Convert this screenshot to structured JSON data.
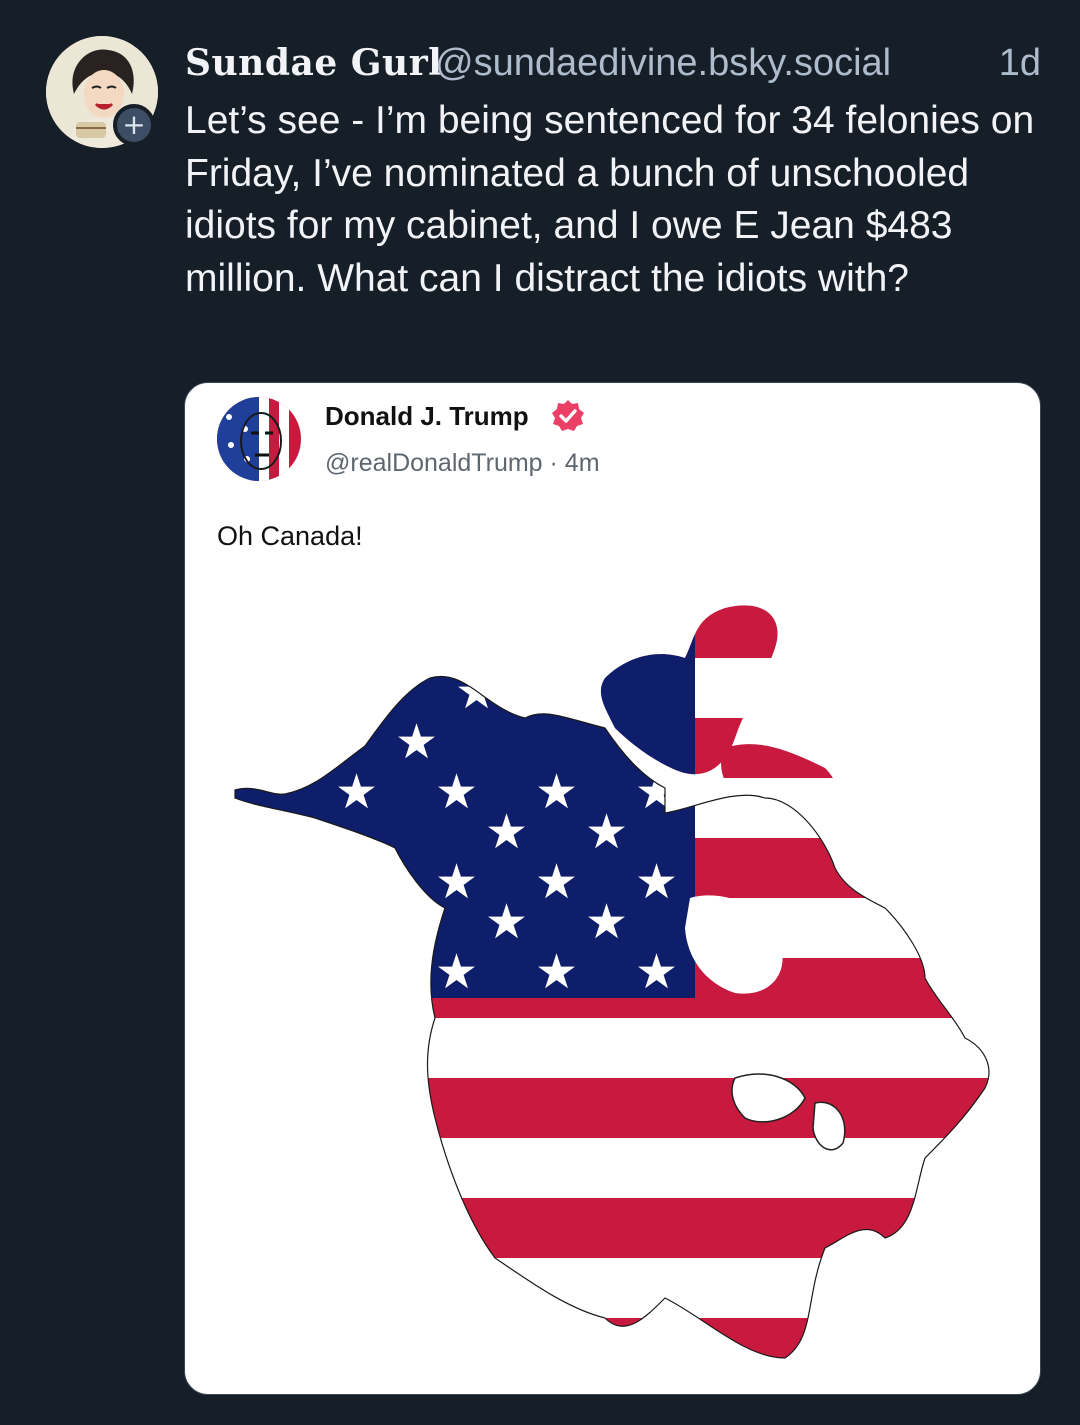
{
  "post": {
    "author_name": "Sundae Gurl",
    "handle": "@sundaedivine.bsky.social",
    "timestamp": "1d",
    "follow_label": "+",
    "text": "Let’s see - I’m being sentenced for 34 felonies on Friday, I’ve nominated a bunch of unschooled idiots for my cabinet, and I owe E Jean $483 million. What can I distract the idiots with?"
  },
  "embed": {
    "author_name": "Donald J. Trump",
    "handle": "@realDonaldTrump · 4m",
    "verified_icon": "verified-badge-icon",
    "text": "Oh Canada!",
    "image_icon": "north-america-flag-map"
  },
  "colors": {
    "background": "#161e27",
    "flag_red": "#c8193f",
    "flag_blue": "#0f1e6a",
    "verified_pink": "#ec3f66"
  }
}
